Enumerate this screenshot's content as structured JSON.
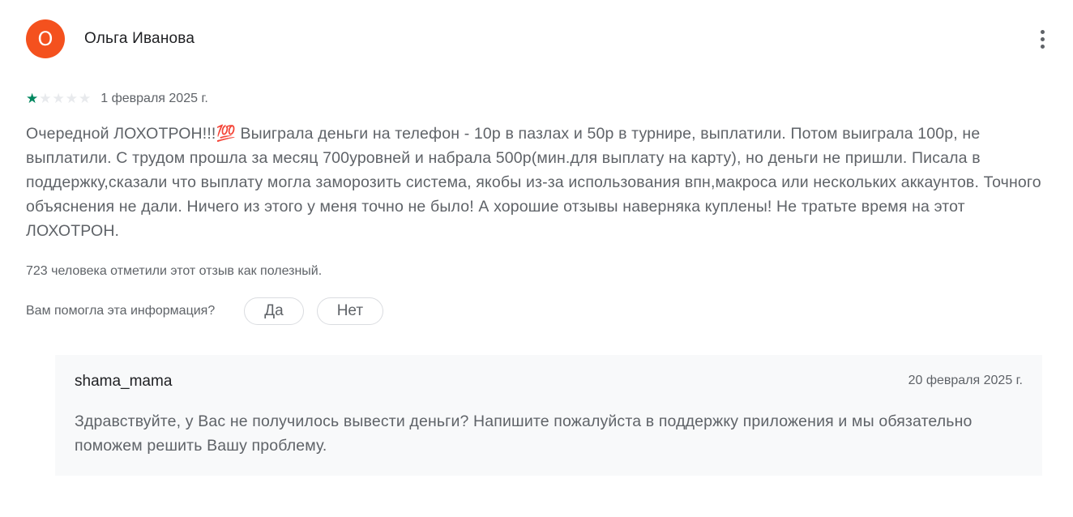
{
  "review": {
    "avatar_letter": "О",
    "avatar_color": "#f4511e",
    "author": "Ольга Иванова",
    "menu_icon": "more-vert-icon",
    "rating": 1,
    "rating_max": 5,
    "star_icon": "star-icon",
    "star_on_color": "#01875f",
    "date": "1 февраля 2025 г.",
    "text": "Очередной ЛОХОТРОН!!!💯 Выиграла деньги на телефон - 10р в пазлах и 50р в турнире, выплатили. Потом выиграла 100р, не выплатили. С трудом прошла за месяц 700уровней и набрала 500р(мин.для выплату на карту), но деньги не пришли. Писала в поддержку,сказали что выплату могла заморозить система, якобы из-за использования впн,макроса или нескольких аккаунтов. Точного объяснения не дали. Ничего из этого у меня точно не было! А хорошие отзывы наверняка куплены! Не тратьте время на этот ЛОХОТРОН.",
    "helpful_count": "723 человека отметили этот отзыв как полезный.",
    "helpful_question": "Вам помогла эта информация?",
    "yes_label": "Да",
    "no_label": "Нет"
  },
  "reply": {
    "developer": "shama_mama",
    "date": "20 февраля 2025 г.",
    "text": "Здравствуйте, у Вас не получилось вывести деньги? Напишите пожалуйста в поддержку приложения и мы обязательно поможем решить Вашу проблему."
  }
}
